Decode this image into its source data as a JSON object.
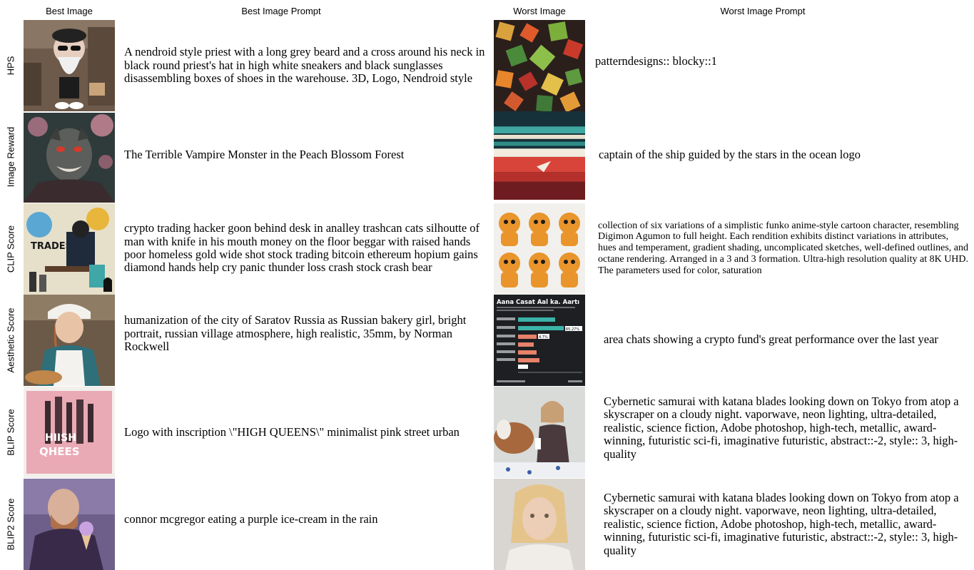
{
  "headers": {
    "best_image": "Best Image",
    "best_prompt": "Best Image Prompt",
    "worst_image": "Worst Image",
    "worst_prompt": "Worst Image Prompt"
  },
  "rows": [
    {
      "metric": "HPS",
      "best_prompt": "A nendroid style priest with a long grey beard and a cross around his neck in black round priest's hat in high white sneakers and black sunglasses disassembling boxes of shoes in the warehouse. 3D, Logo, Nendroid style",
      "worst_prompt": "patterndesigns:: blocky::1"
    },
    {
      "metric": "Image Reward",
      "best_prompt": "The Terrible Vampire Monster in the Peach Blossom Forest",
      "worst_prompt": "captain of the ship guided by the stars in the ocean logo"
    },
    {
      "metric": "CLIP Score",
      "best_prompt": "crypto trading hacker goon behind desk in analley trashcan cats silhoutte of man with knife in his mouth money on the floor beggar with raised hands poor homeless gold wide shot stock trading bitcoin ethereum hopium gains diamond hands help cry panic thunder loss crash stock crash bear",
      "worst_prompt": "collection of six variations of a simplistic funko anime-style cartoon character, resembling Digimon Agumon to full height. Each rendition exhibits distinct variations in attributes, hues and temperament, gradient shading, uncomplicated sketches, well-defined outlines, and octane rendering. Arranged in a 3 and 3 formation. Ultra-high resolution quality at 8K UHD. The parameters used for color, saturation"
    },
    {
      "metric": "Aesthetic Score",
      "best_prompt": "humanization of the city of Saratov Russia as Russian bakery girl, bright portrait, russian village atmosphere, high realistic, 35mm, by Norman Rockwell",
      "worst_prompt": "area chats showing a crypto fund's great performance over the last year"
    },
    {
      "metric": "BLIP Score",
      "best_prompt": "Logo with inscription \\\"HIGH QUEENS\\\" minimalist pink street urban",
      "worst_prompt": "Cybernetic samurai with katana blades looking down on Tokyo from atop a skyscraper on a cloudy night. vaporwave, neon lighting, ultra-detailed, realistic, science fiction, Adobe photoshop, high-tech, metallic, award-winning, futuristic sci-fi, imaginative futuristic, abstract::-2, style:: 3, high-quality"
    },
    {
      "metric": "BLIP2 Score",
      "best_prompt": "connor mcgregor eating a purple ice-cream in the rain",
      "worst_prompt": "Cybernetic samurai with katana blades looking down on Tokyo from atop a skyscraper on a cloudy night. vaporwave, neon lighting, ultra-detailed, realistic, science fiction, Adobe photoshop, high-tech, metallic, award-winning, futuristic sci-fi, imaginative futuristic, abstract::-2, style:: 3, high-quality"
    }
  ],
  "image_texts": {
    "clip_best_sign": "TRADESK",
    "aesthetic_worst_title": "Aana Casat Aal ka. Aartı",
    "aesthetic_worst_label": "65.27%",
    "aesthetic_worst_label2": "4.7%",
    "blip_best_logo_1": "HIISH",
    "blip_best_logo_2": "QHEES"
  }
}
